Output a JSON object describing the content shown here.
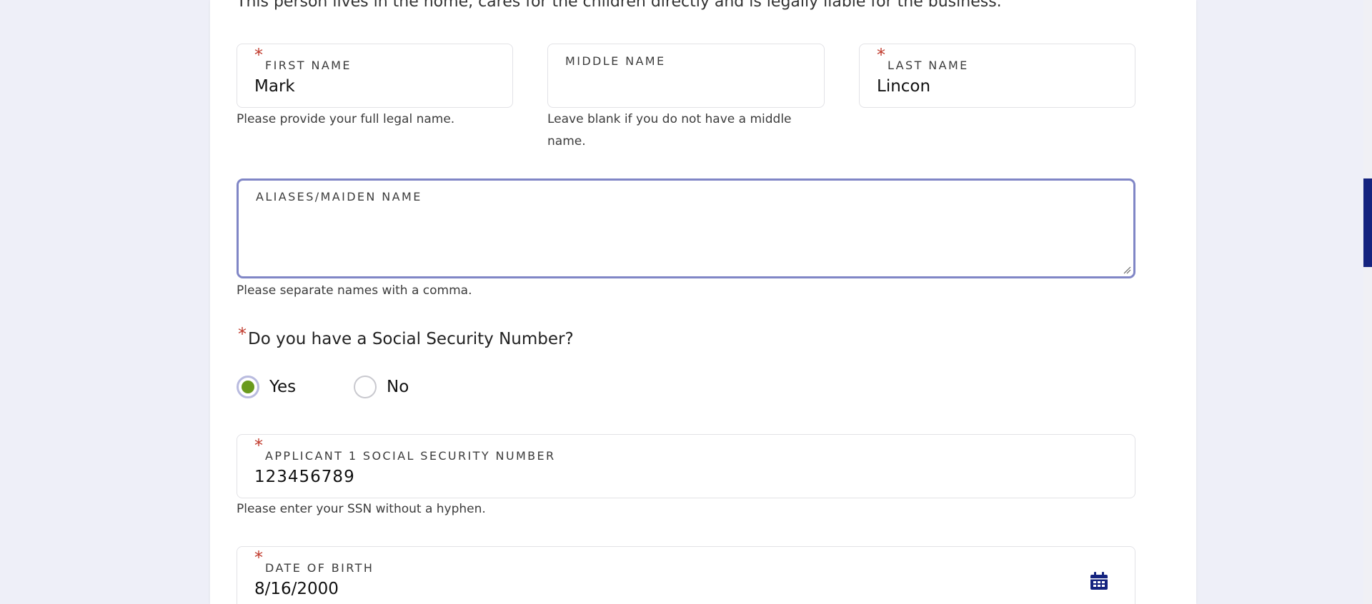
{
  "intro_text": "This person lives in the home, cares for the children directly and is legally liable for the business.",
  "first_name": {
    "label": "FIRST NAME",
    "required_mark": "*",
    "value": "Mark",
    "help": "Please provide your full legal name."
  },
  "middle_name": {
    "label": "MIDDLE NAME",
    "value": "",
    "help": "Leave blank if you do not have a middle name."
  },
  "last_name": {
    "label": "LAST NAME",
    "required_mark": "*",
    "value": "Lincon"
  },
  "aliases": {
    "label": "ALIASES/MAIDEN NAME",
    "value": "",
    "help": "Please separate names with a comma."
  },
  "ssn_question": {
    "required_mark": "*",
    "text": "Do you have a Social Security Number?",
    "options": [
      "Yes",
      "No"
    ],
    "selected": "Yes"
  },
  "ssn": {
    "label": "APPLICANT 1 SOCIAL SECURITY NUMBER",
    "required_mark": "*",
    "value": "123456789",
    "help": "Please enter your SSN without a hyphen."
  },
  "dob": {
    "label": "DATE OF BIRTH",
    "required_mark": "*",
    "value": "8/16/2000",
    "icon": "calendar-icon"
  },
  "colors": {
    "accent": "#14237f",
    "radio_selected": "#6a9a1e",
    "required": "#c0392b",
    "focus_border": "#8086c6"
  }
}
